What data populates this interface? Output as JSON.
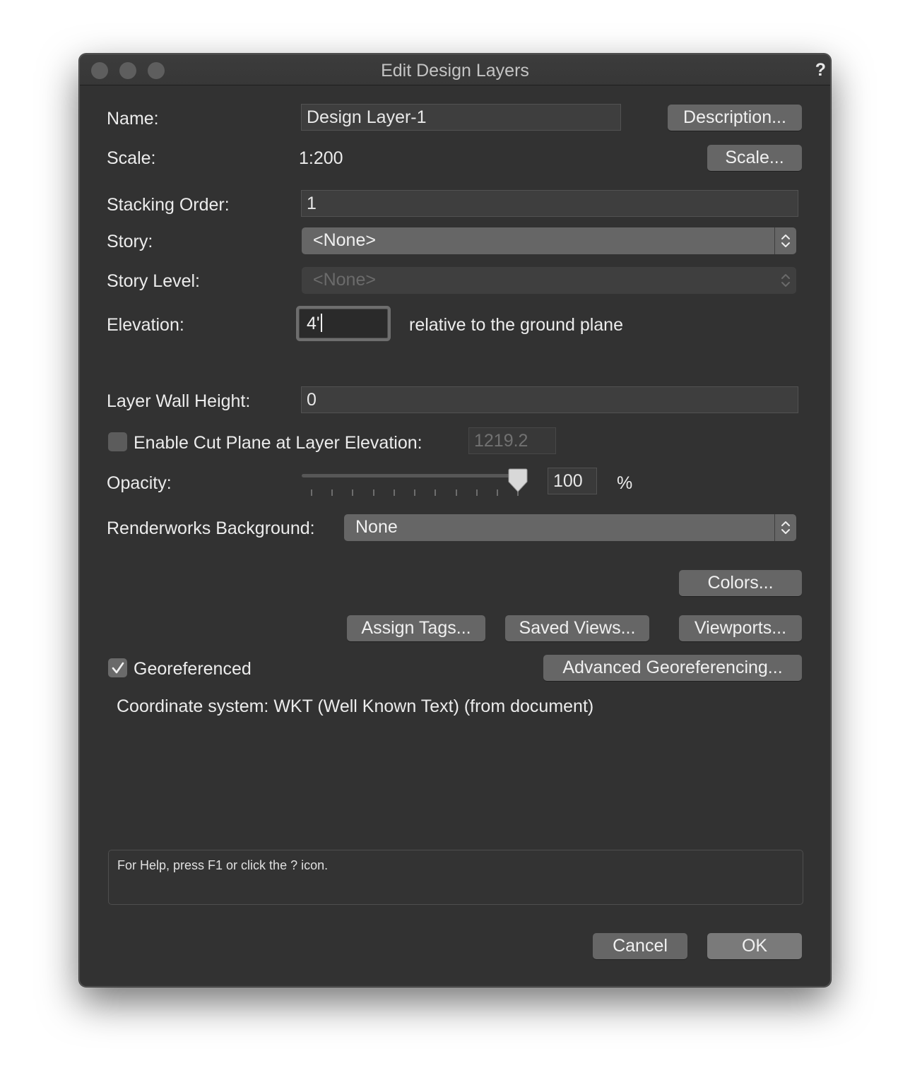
{
  "window": {
    "title": "Edit Design Layers",
    "help_glyph": "?"
  },
  "name": {
    "label": "Name:",
    "value": "Design Layer-1",
    "description_button": "Description..."
  },
  "scale": {
    "label": "Scale:",
    "value": "1:200",
    "button": "Scale..."
  },
  "stacking_order": {
    "label": "Stacking Order:",
    "value": "1"
  },
  "story": {
    "label": "Story:",
    "selected": "<None>"
  },
  "story_level": {
    "label": "Story Level:",
    "selected": "<None>"
  },
  "elevation": {
    "label": "Elevation:",
    "value": "4'",
    "suffix": "relative to the ground plane"
  },
  "layer_wall_height": {
    "label": "Layer Wall Height:",
    "value": "0"
  },
  "cut_plane": {
    "label": "Enable Cut Plane at Layer Elevation:",
    "checked": false,
    "value": "1219.2"
  },
  "opacity": {
    "label": "Opacity:",
    "value": "100",
    "unit": "%",
    "slider_percent": 100
  },
  "renderworks_background": {
    "label": "Renderworks Background:",
    "selected": "None"
  },
  "buttons": {
    "colors": "Colors...",
    "assign_tags": "Assign Tags...",
    "saved_views": "Saved Views...",
    "viewports": "Viewports...",
    "advanced_georeferencing": "Advanced Georeferencing...",
    "cancel": "Cancel",
    "ok": "OK"
  },
  "georeferenced": {
    "label": "Georeferenced",
    "checked": true
  },
  "coordinate_system": "Coordinate system: WKT (Well Known Text) (from document)",
  "help_text": "For Help, press F1 or click the ? icon.",
  "icons": {
    "window_controls": [
      "close-button",
      "minimize-button",
      "zoom-button"
    ],
    "popup_arrows": "up-down-chevron-icon",
    "checkmark": "checkmark-icon"
  },
  "colors": {
    "window_bg": "#323232",
    "button_bg": "#666666",
    "field_bg": "#3e3e3e",
    "text": "#ececec"
  }
}
